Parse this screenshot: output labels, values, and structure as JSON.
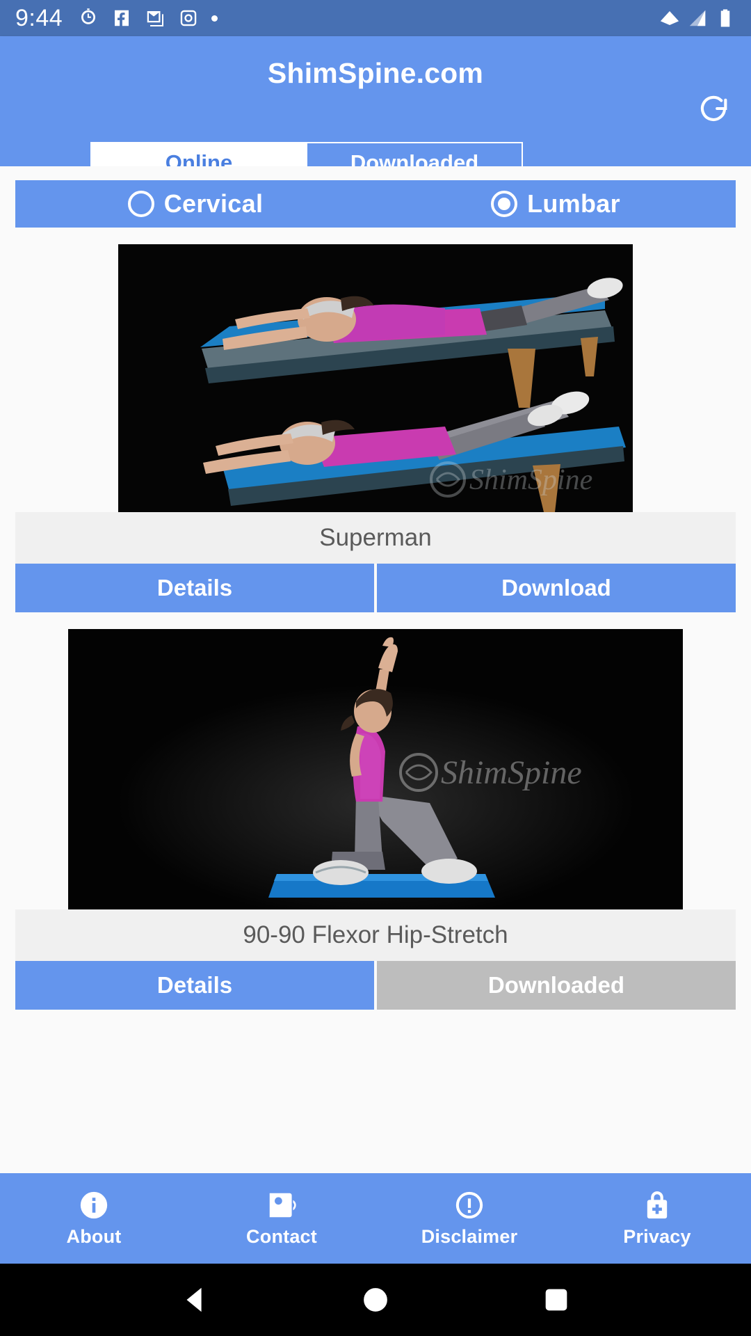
{
  "status_bar": {
    "clock": "9:44",
    "left_icons": [
      "alarm-icon",
      "facebook-icon",
      "gmail-icon",
      "instagram-icon",
      "dot-icon"
    ],
    "right_icons": [
      "wifi-icon",
      "cell-signal-icon",
      "battery-icon"
    ],
    "background": "#4770B3"
  },
  "app_bar": {
    "title": "ShimSpine.com",
    "refresh_icon": "refresh-icon",
    "background": "#6495ED",
    "tabs": [
      {
        "label": "Online",
        "active": true
      },
      {
        "label": "Downloaded",
        "active": false
      }
    ]
  },
  "region_selector": {
    "options": [
      {
        "label": "Cervical",
        "selected": false
      },
      {
        "label": "Lumbar",
        "selected": true
      }
    ],
    "background": "#6495ED"
  },
  "exercises": [
    {
      "title": "Superman",
      "image_alt": "woman performing superman exercise on a treatment table",
      "watermark": "ShimSpine",
      "buttons": [
        {
          "label": "Details",
          "state": "enabled"
        },
        {
          "label": "Download",
          "state": "enabled"
        }
      ]
    },
    {
      "title": "90-90 Flexor Hip-Stretch",
      "image_alt": "woman kneeling in half-kneel hip flexor stretch with arm raised",
      "watermark": "ShimSpine",
      "buttons": [
        {
          "label": "Details",
          "state": "enabled"
        },
        {
          "label": "Downloaded",
          "state": "disabled"
        }
      ]
    }
  ],
  "bottom_nav": [
    {
      "label": "About",
      "icon": "info-circle-icon"
    },
    {
      "label": "Contact",
      "icon": "contact-card-icon"
    },
    {
      "label": "Disclaimer",
      "icon": "exclamation-circle-icon"
    },
    {
      "label": "Privacy",
      "icon": "lock-plus-icon"
    }
  ],
  "android_nav": [
    {
      "name": "back-button",
      "icon": "triangle-left-icon"
    },
    {
      "name": "home-button",
      "icon": "circle-icon"
    },
    {
      "name": "recents-button",
      "icon": "square-icon"
    }
  ],
  "colors": {
    "accent": "#6495ED",
    "status_bar": "#4770B3",
    "disabled": "#BDBDBD",
    "title_strip": "#F0F0F0",
    "page_bg": "#FAFAFA"
  }
}
